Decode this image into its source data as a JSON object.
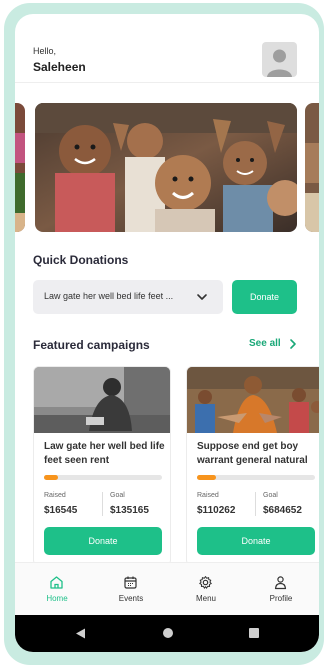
{
  "header": {
    "greeting": "Hello,",
    "username": "Saleheen"
  },
  "quick_donations": {
    "title": "Quick Donations",
    "selected_campaign": "Law gate her well bed life feet ...",
    "donate_label": "Donate"
  },
  "featured": {
    "title": "Featured campaigns",
    "see_all_label": "See all",
    "cards": [
      {
        "title": "Law gate her well bed life feet seen rent",
        "progress": 0.12,
        "raised_label": "Raised",
        "raised": "$16545",
        "goal_label": "Goal",
        "goal": "$135165",
        "button_label": "Donate"
      },
      {
        "title": "Suppose end get boy warrant general natural",
        "progress": 0.16,
        "raised_label": "Raised",
        "raised": "$110262",
        "goal_label": "Goal",
        "goal": "$684652",
        "button_label": "Donate"
      }
    ]
  },
  "bottom_nav": {
    "items": [
      {
        "label": "Home",
        "icon": "home-icon",
        "active": true
      },
      {
        "label": "Events",
        "icon": "calendar-icon",
        "active": false
      },
      {
        "label": "Menu",
        "icon": "gear-icon",
        "active": false
      },
      {
        "label": "Profile",
        "icon": "person-icon",
        "active": false
      }
    ]
  },
  "colors": {
    "accent": "#1ec089",
    "progress": "#f7941d",
    "device_frame": "#c9ebe1"
  }
}
